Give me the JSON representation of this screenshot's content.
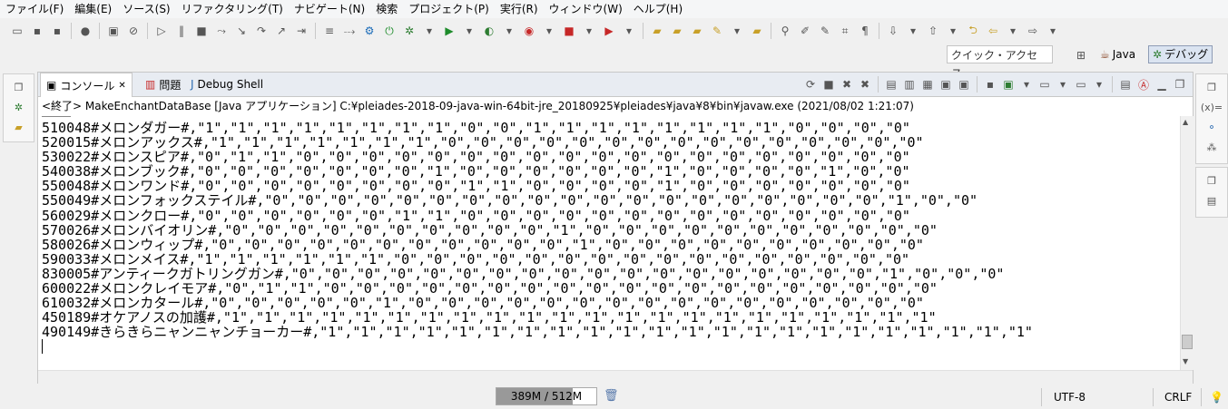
{
  "menu": [
    "ファイル(F)",
    "編集(E)",
    "ソース(S)",
    "リファクタリング(T)",
    "ナビゲート(N)",
    "検索",
    "プロジェクト(P)",
    "実行(R)",
    "ウィンドウ(W)",
    "ヘルプ(H)"
  ],
  "quick_access_placeholder": "クイック・アクセス",
  "perspectives": {
    "java": "Java",
    "debug": "デバッグ"
  },
  "tabs": {
    "console": "コンソール",
    "problems": "問題",
    "debug_shell": "Debug Shell"
  },
  "console_label": "<終了> MakeEnchantDataBase [Java アプリケーション] C:¥pleiades-2018-09-java-win-64bit-jre_20180925¥pleiades¥java¥8¥bin¥javaw.exe (2021/08/02 1:21:07)",
  "output_lines": [
    "510048#メロンダガー#,\"1\",\"1\",\"1\",\"1\",\"1\",\"1\",\"1\",\"1\",\"0\",\"0\",\"1\",\"1\",\"1\",\"1\",\"1\",\"1\",\"1\",\"1\",\"0\",\"0\",\"0\",\"0\"",
    "520015#メロンアックス#,\"1\",\"1\",\"1\",\"1\",\"1\",\"1\",\"1\",\"0\",\"0\",\"0\",\"0\",\"0\",\"0\",\"0\",\"0\",\"0\",\"0\",\"0\",\"0\",\"0\",\"0\",\"0\"",
    "530022#メロンスピア#,\"0\",\"1\",\"1\",\"0\",\"0\",\"0\",\"0\",\"0\",\"0\",\"0\",\"0\",\"0\",\"0\",\"0\",\"0\",\"0\",\"0\",\"0\",\"0\",\"0\",\"0\",\"0\"",
    "540038#メロンブック#,\"0\",\"0\",\"0\",\"0\",\"0\",\"0\",\"0\",\"1\",\"0\",\"0\",\"0\",\"0\",\"0\",\"0\",\"1\",\"0\",\"0\",\"0\",\"0\",\"1\",\"0\",\"0\"",
    "550048#メロンワンド#,\"0\",\"0\",\"0\",\"0\",\"0\",\"0\",\"0\",\"0\",\"1\",\"1\",\"0\",\"0\",\"0\",\"0\",\"1\",\"0\",\"0\",\"0\",\"0\",\"0\",\"0\",\"0\"",
    "550049#メロンフォックステイル#,\"0\",\"0\",\"0\",\"0\",\"0\",\"0\",\"0\",\"0\",\"0\",\"0\",\"0\",\"0\",\"0\",\"0\",\"0\",\"0\",\"0\",\"0\",\"0\",\"1\",\"0\",\"0\"",
    "560029#メロンクロー#,\"0\",\"0\",\"0\",\"0\",\"0\",\"0\",\"1\",\"1\",\"0\",\"0\",\"0\",\"0\",\"0\",\"0\",\"0\",\"0\",\"0\",\"0\",\"0\",\"0\",\"0\",\"0\"",
    "570026#メロンバイオリン#,\"0\",\"0\",\"0\",\"0\",\"0\",\"0\",\"0\",\"0\",\"0\",\"0\",\"1\",\"0\",\"0\",\"0\",\"0\",\"0\",\"0\",\"0\",\"0\",\"0\",\"0\",\"0\"",
    "580026#メロンウィップ#,\"0\",\"0\",\"0\",\"0\",\"0\",\"0\",\"0\",\"0\",\"0\",\"0\",\"0\",\"1\",\"0\",\"0\",\"0\",\"0\",\"0\",\"0\",\"0\",\"0\",\"0\",\"0\"",
    "590033#メロンメイス#,\"1\",\"1\",\"1\",\"1\",\"1\",\"1\",\"0\",\"0\",\"0\",\"0\",\"0\",\"0\",\"0\",\"0\",\"0\",\"0\",\"0\",\"0\",\"0\",\"0\",\"0\",\"0\"",
    "830005#アンティークガトリングガン#,\"0\",\"0\",\"0\",\"0\",\"0\",\"0\",\"0\",\"0\",\"0\",\"0\",\"0\",\"0\",\"0\",\"0\",\"0\",\"0\",\"0\",\"0\",\"1\",\"0\",\"0\",\"0\"",
    "600022#メロンクレイモア#,\"0\",\"1\",\"1\",\"0\",\"0\",\"0\",\"0\",\"0\",\"0\",\"0\",\"0\",\"0\",\"0\",\"0\",\"0\",\"0\",\"0\",\"0\",\"0\",\"0\",\"0\",\"0\"",
    "610032#メロンカタール#,\"0\",\"0\",\"0\",\"0\",\"0\",\"1\",\"0\",\"0\",\"0\",\"0\",\"0\",\"0\",\"0\",\"0\",\"0\",\"0\",\"0\",\"0\",\"0\",\"0\",\"0\",\"0\"",
    "450189#オケアノスの加護#,\"1\",\"1\",\"1\",\"1\",\"1\",\"1\",\"1\",\"1\",\"1\",\"1\",\"1\",\"1\",\"1\",\"1\",\"1\",\"1\",\"1\",\"1\",\"1\",\"1\",\"1\",\"1\"",
    "490149#きらきらニャンニャンチョーカー#,\"1\",\"1\",\"1\",\"1\",\"1\",\"1\",\"1\",\"1\",\"1\",\"1\",\"1\",\"1\",\"1\",\"1\",\"1\",\"1\",\"1\",\"1\",\"1\",\"1\",\"1\",\"1\""
  ],
  "status": {
    "heap": "389M / 512M",
    "heap_used_fraction": 0.76,
    "encoding": "UTF-8",
    "line_delimiter": "CRLF"
  }
}
